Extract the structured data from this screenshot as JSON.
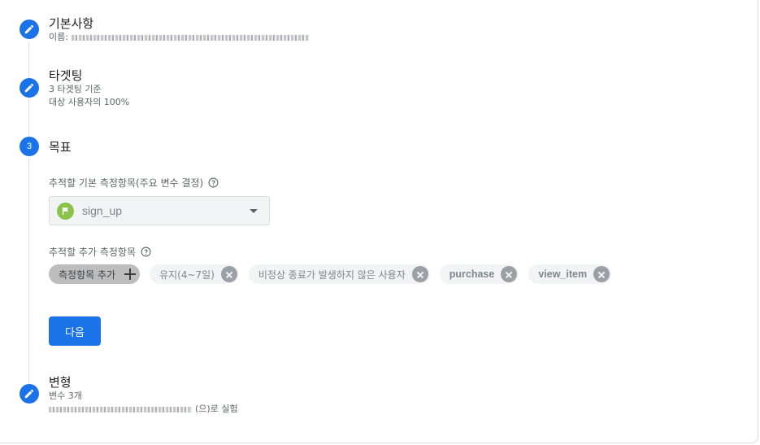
{
  "steps": {
    "basic": {
      "title": "기본사항",
      "name_prefix": "이름:"
    },
    "targeting": {
      "title": "타겟팅",
      "line1": "3 타겟팅 기준",
      "line2": "대상 사용자의 100%"
    },
    "objective": {
      "number": "3",
      "title": "목표",
      "primary_label": "추적할 기본 측정항목(주요 변수 결정)",
      "primary_value": "sign_up",
      "additional_label": "추적할 추가 측정항목",
      "add_metric_label": "측정항목 추가",
      "chips": [
        {
          "label": "유지(4~7일)",
          "bold": false
        },
        {
          "label": "비정상 종료가 발생하지 않은 사용자",
          "bold": false
        },
        {
          "label": "purchase",
          "bold": true
        },
        {
          "label": "view_item",
          "bold": true
        }
      ],
      "next_label": "다음"
    },
    "variants": {
      "title": "변형",
      "line1": "변수 3개",
      "line2_suffix": "(으)로 실험"
    }
  },
  "colors": {
    "accent": "#1a73e8",
    "flag": "#8bc34a",
    "chip_bg": "#f1f3f4"
  }
}
